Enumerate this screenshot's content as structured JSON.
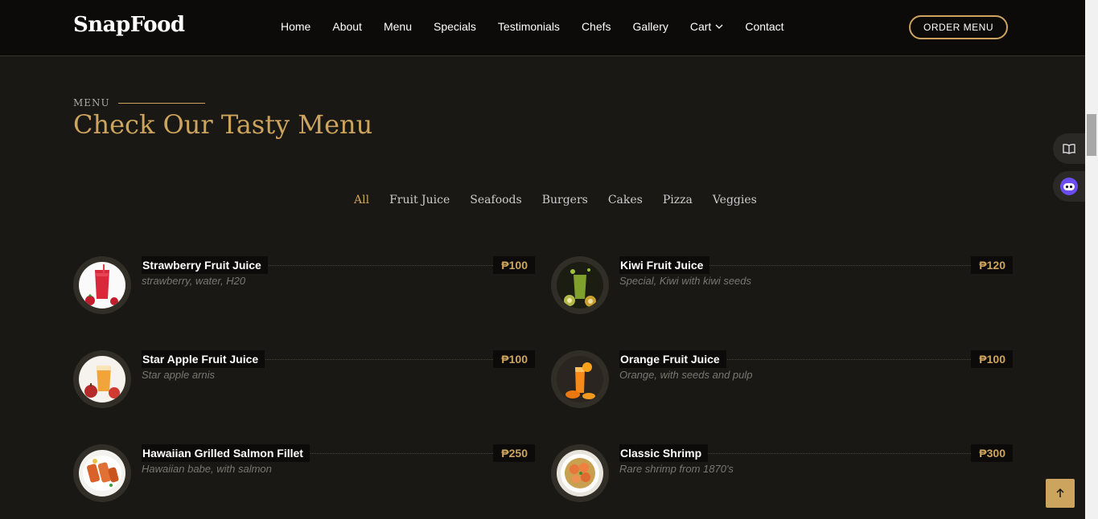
{
  "header": {
    "logo": "SnapFood",
    "nav": [
      "Home",
      "About",
      "Menu",
      "Specials",
      "Testimonials",
      "Chefs",
      "Gallery",
      "Cart",
      "Contact"
    ],
    "order_button": "ORDER MENU"
  },
  "section": {
    "subtitle": "MENU",
    "title": "Check Our Tasty Menu"
  },
  "filters": {
    "active": "All",
    "items": [
      "All",
      "Fruit Juice",
      "Seafoods",
      "Burgers",
      "Cakes",
      "Pizza",
      "Veggies"
    ]
  },
  "menu_items": [
    {
      "name": "Strawberry Fruit Juice",
      "price": "₱100",
      "desc": "strawberry, water, H20",
      "icon": "strawberry-juice-image"
    },
    {
      "name": "Kiwi Fruit Juice",
      "price": "₱120",
      "desc": "Special, Kiwi with kiwi seeds",
      "icon": "kiwi-juice-image"
    },
    {
      "name": "Star Apple Fruit Juice",
      "price": "₱100",
      "desc": "Star apple arnis",
      "icon": "star-apple-juice-image"
    },
    {
      "name": "Orange Fruit Juice",
      "price": "₱100",
      "desc": "Orange, with seeds and pulp",
      "icon": "orange-juice-image"
    },
    {
      "name": "Hawaiian Grilled Salmon Fillet",
      "price": "₱250",
      "desc": "Hawaiian babe, with salmon",
      "icon": "salmon-fillet-image"
    },
    {
      "name": "Classic Shrimp",
      "price": "₱300",
      "desc": "Rare shrimp from 1870's",
      "icon": "shrimp-image"
    }
  ],
  "colors": {
    "accent": "#cda45e",
    "background": "#1a1814",
    "header_bg": "#0c0b09"
  },
  "side_icons": [
    "book-icon",
    "bot-icon"
  ],
  "back_to_top_icon": "arrow-up-icon"
}
